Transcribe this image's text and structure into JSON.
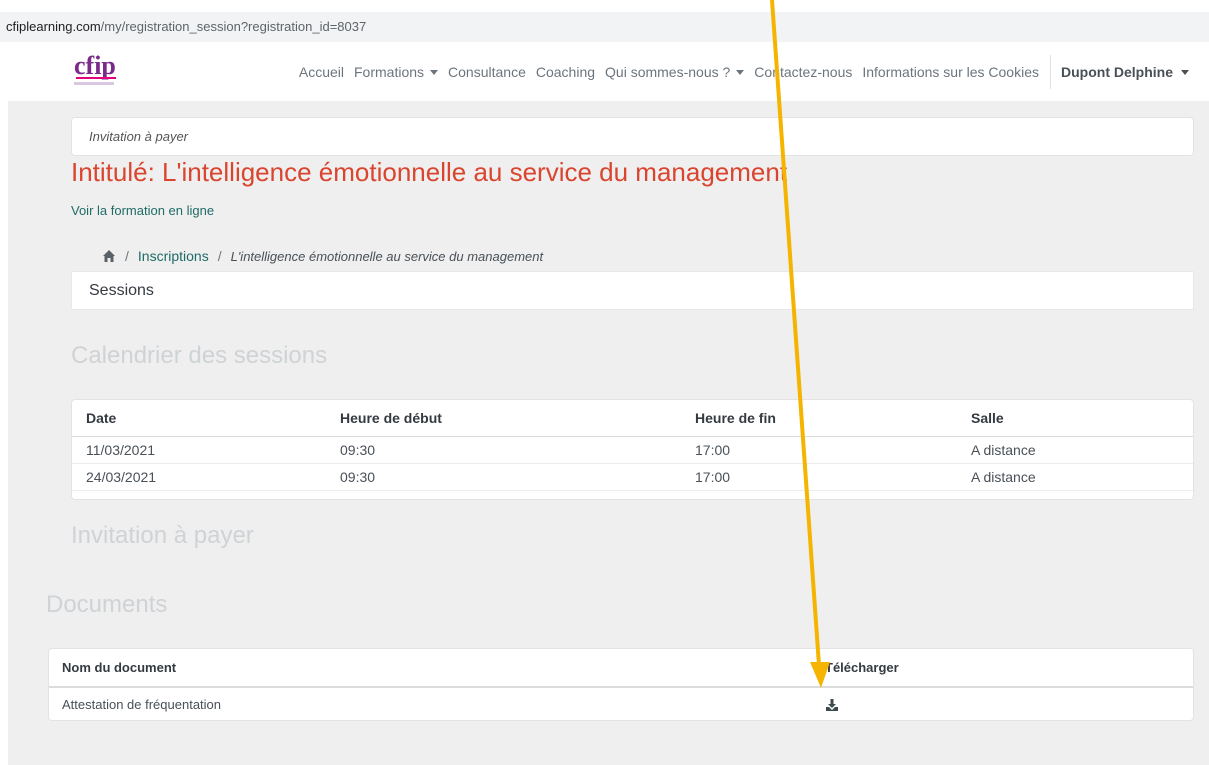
{
  "browser": {
    "url_domain": "cfiplearning.com",
    "url_path": "/my/registration_session?registration_id=8037"
  },
  "navbar": {
    "logo_text": "cfip",
    "items": [
      {
        "label": "Accueil",
        "dropdown": false
      },
      {
        "label": "Formations",
        "dropdown": true
      },
      {
        "label": "Consultance",
        "dropdown": false
      },
      {
        "label": "Coaching",
        "dropdown": false
      },
      {
        "label": "Qui sommes-nous ?",
        "dropdown": true
      },
      {
        "label": "Contactez-nous",
        "dropdown": false
      },
      {
        "label": "Informations sur les Cookies",
        "dropdown": false
      }
    ],
    "user_name": "Dupont Delphine"
  },
  "page": {
    "invitation_label": "Invitation à payer",
    "title": "Intitulé: L'intelligence émotionnelle au service du management",
    "online_link": "Voir la formation en ligne",
    "breadcrumb": {
      "home_icon": "home-icon",
      "sep": "/",
      "link": "Inscriptions",
      "active": "L'intelligence émotionnelle au service du management"
    },
    "sessions_header": "Sessions",
    "calendar_title": "Calendrier des sessions",
    "invitation_title": "Invitation à payer",
    "documents_title": "Documents"
  },
  "sessions_table": {
    "headers": [
      "Date",
      "Heure de début",
      "Heure de fin",
      "Salle"
    ],
    "rows": [
      [
        "11/03/2021",
        "09:30",
        "17:00",
        "A distance"
      ],
      [
        "24/03/2021",
        "09:30",
        "17:00",
        "A distance"
      ]
    ]
  },
  "documents_table": {
    "headers": [
      "Nom du document",
      "Télécharger"
    ],
    "rows": [
      {
        "name": "Attestation de fréquentation",
        "download_icon": "download-icon"
      }
    ]
  },
  "colors": {
    "title": "#d9452f",
    "link": "#1f6b66",
    "annotation_arrow": "#f5b400",
    "page_bg": "#efefef"
  }
}
